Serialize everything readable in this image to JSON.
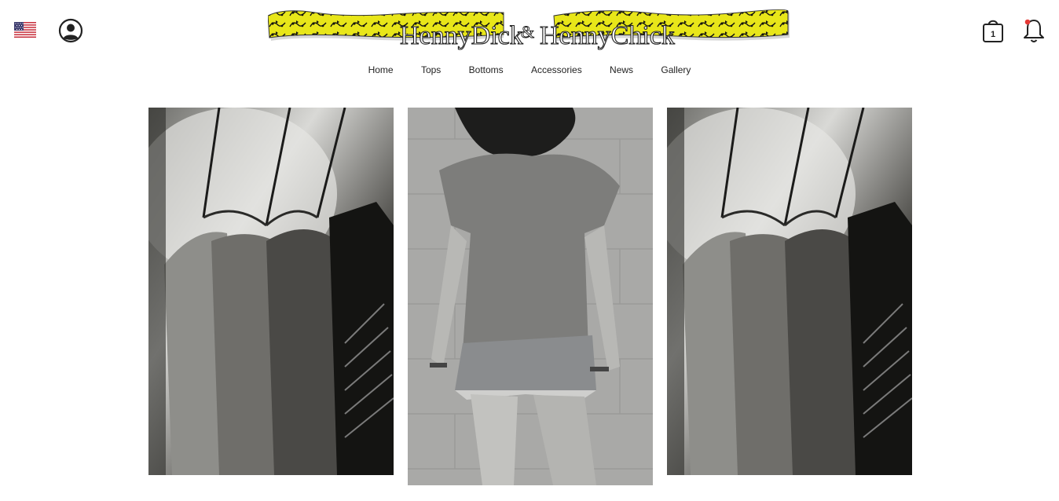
{
  "header": {
    "flag_icon": "us-flag-icon",
    "account_icon": "user-circle-icon",
    "logo_text_left": "HennyDick",
    "logo_amp": "&",
    "logo_text_right": "HennyChick",
    "cart_icon": "shopping-bag-icon",
    "cart_count": "1",
    "bell_icon": "bell-icon",
    "colors": {
      "logo_yellow": "#e8e619",
      "notification_dot": "#e53935",
      "icon_stroke": "#222222"
    }
  },
  "nav": {
    "items": [
      {
        "label": "Home"
      },
      {
        "label": "Tops"
      },
      {
        "label": "Bottoms"
      },
      {
        "label": "Accessories"
      },
      {
        "label": "News"
      },
      {
        "label": "Gallery"
      }
    ]
  },
  "gallery": {
    "photos": [
      {
        "subject": "hanging-shirts-photo"
      },
      {
        "subject": "woman-tshirt-shorts-photo"
      },
      {
        "subject": "hanging-shirts-photo"
      }
    ]
  }
}
